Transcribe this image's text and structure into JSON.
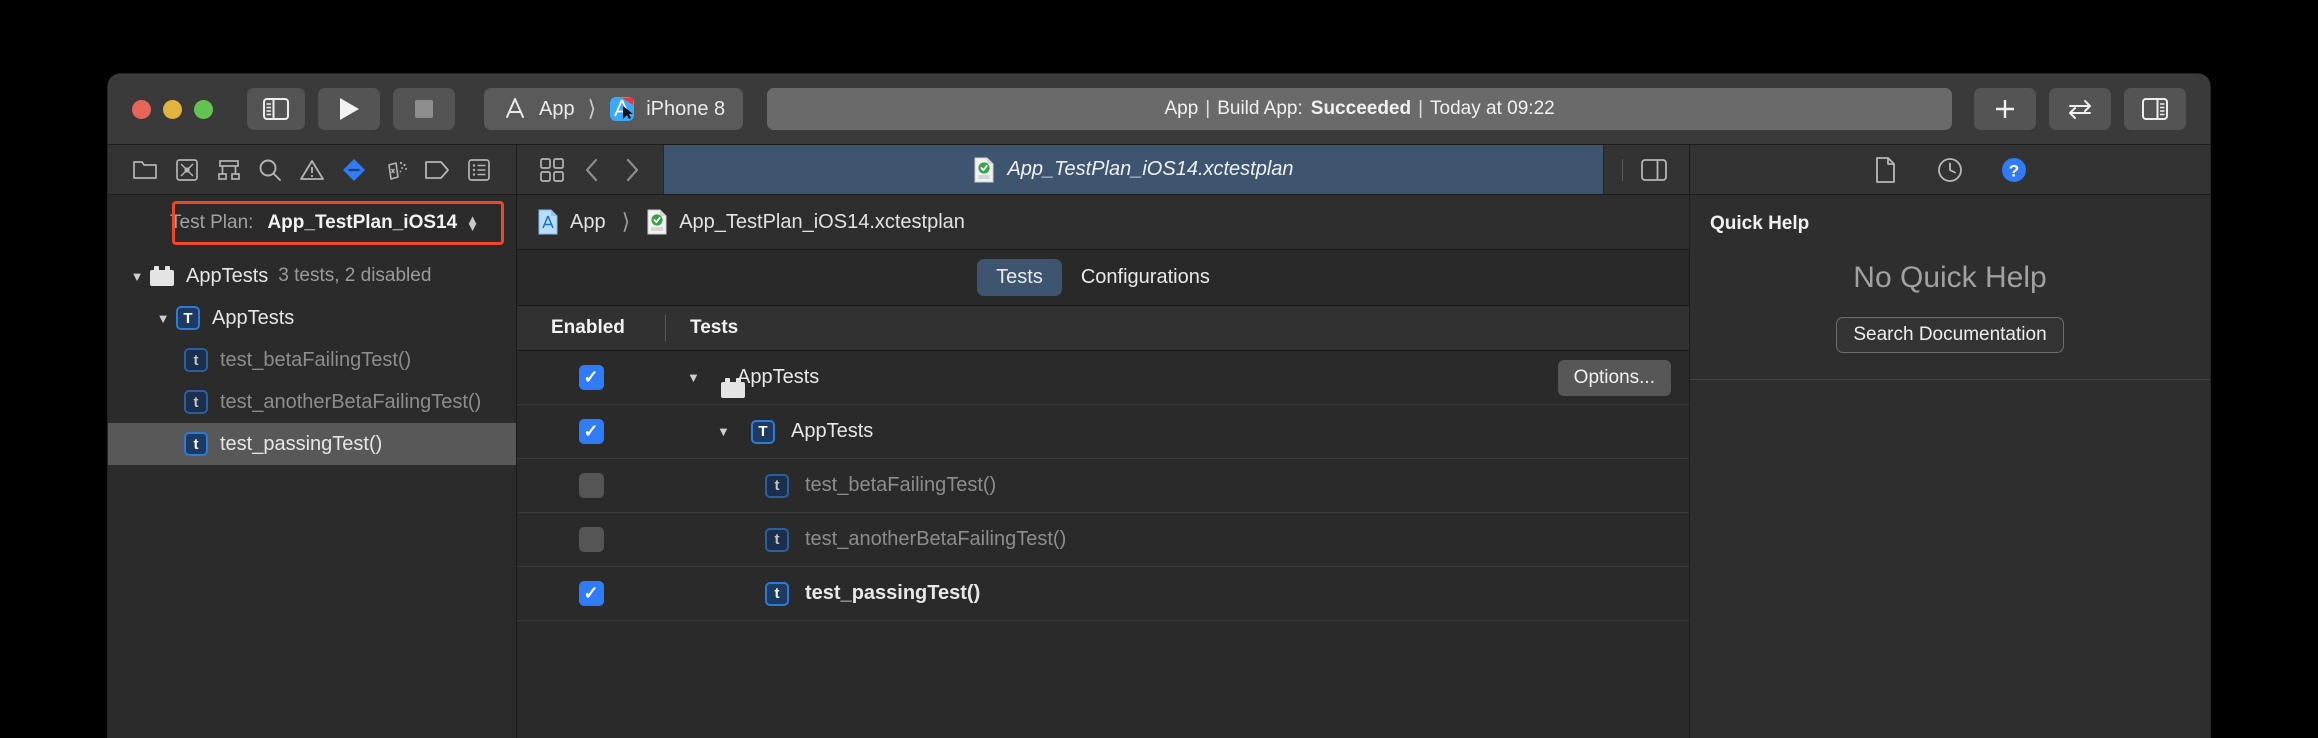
{
  "toolbar": {
    "window_controls": [
      "close",
      "minimize",
      "zoom"
    ],
    "navigator_toggle": "toggle-navigator",
    "run_label": "run",
    "stop_label": "stop",
    "scheme": {
      "target": "App",
      "destination": "iPhone 8"
    },
    "status": {
      "project": "App",
      "sep": "|",
      "action": "Build App:",
      "result": "Succeeded",
      "time": "Today at 09:22"
    },
    "add_label": "+",
    "swap_label": "swap-editors",
    "inspector_toggle": "toggle-inspector"
  },
  "navigator": {
    "tabs": [
      {
        "name": "project-navigator",
        "selected": false
      },
      {
        "name": "source-control-navigator",
        "selected": false
      },
      {
        "name": "symbol-navigator",
        "selected": false
      },
      {
        "name": "find-navigator",
        "selected": false
      },
      {
        "name": "issue-navigator",
        "selected": false
      },
      {
        "name": "test-navigator",
        "selected": true
      },
      {
        "name": "debug-navigator",
        "selected": false
      },
      {
        "name": "breakpoint-navigator",
        "selected": false
      },
      {
        "name": "report-navigator",
        "selected": false
      }
    ],
    "test_plan": {
      "label": "Test Plan:",
      "value": "App_TestPlan_iOS14",
      "highlight_color": "#f0462b"
    },
    "tree": [
      {
        "label": "AppTests",
        "detail": "3 tests, 2 disabled",
        "icon": "test-bundle-icon",
        "level": 0,
        "expanded": true,
        "selected": false,
        "disabled": false
      },
      {
        "label": "AppTests",
        "detail": "",
        "icon": "test-class-icon",
        "level": 1,
        "expanded": true,
        "selected": false,
        "disabled": false
      },
      {
        "label": "test_betaFailingTest()",
        "detail": "",
        "icon": "test-method-icon",
        "level": 2,
        "expanded": false,
        "selected": false,
        "disabled": true
      },
      {
        "label": "test_anotherBetaFailingTest()",
        "detail": "",
        "icon": "test-method-icon",
        "level": 2,
        "expanded": false,
        "selected": false,
        "disabled": true
      },
      {
        "label": "test_passingTest()",
        "detail": "",
        "icon": "test-method-icon",
        "level": 2,
        "expanded": false,
        "selected": true,
        "disabled": false
      }
    ]
  },
  "editor": {
    "tab_title": "App_TestPlan_iOS14.xctestplan",
    "breadcrumb": [
      {
        "label": "App",
        "icon": "project-icon"
      },
      {
        "label": "App_TestPlan_iOS14.xctestplan",
        "icon": "testplan-icon"
      }
    ],
    "segments": [
      {
        "label": "Tests",
        "active": true
      },
      {
        "label": "Configurations",
        "active": false
      }
    ],
    "table": {
      "columns": [
        "Enabled",
        "Tests"
      ],
      "options_label": "Options...",
      "rows": [
        {
          "enabled": true,
          "indent": 0,
          "disclosure": "▼",
          "icon": "test-bundle-icon",
          "label": "AppTests",
          "dim": false,
          "bold": false,
          "has_options": true
        },
        {
          "enabled": true,
          "indent": 1,
          "disclosure": "▼",
          "icon": "test-class-icon",
          "label": "AppTests",
          "dim": false,
          "bold": false,
          "has_options": false
        },
        {
          "enabled": false,
          "indent": 2,
          "disclosure": "",
          "icon": "test-method-icon",
          "label": "test_betaFailingTest()",
          "dim": true,
          "bold": false,
          "has_options": false
        },
        {
          "enabled": false,
          "indent": 2,
          "disclosure": "",
          "icon": "test-method-icon",
          "label": "test_anotherBetaFailingTest()",
          "dim": true,
          "bold": false,
          "has_options": false
        },
        {
          "enabled": true,
          "indent": 2,
          "disclosure": "",
          "icon": "test-method-icon",
          "label": "test_passingTest()",
          "dim": false,
          "bold": true,
          "has_options": false
        }
      ]
    }
  },
  "inspector": {
    "tabs": [
      {
        "name": "file-inspector",
        "selected": false
      },
      {
        "name": "history-inspector",
        "selected": false
      },
      {
        "name": "quick-help-inspector",
        "selected": true
      }
    ],
    "quick_help": {
      "title": "Quick Help",
      "empty_message": "No Quick Help",
      "search_button": "Search Documentation"
    }
  },
  "colors": {
    "accent_blue": "#2f7cf6",
    "tab_blue": "#3e5570",
    "highlight_red": "#f0462b",
    "window_bg": "#292929"
  }
}
